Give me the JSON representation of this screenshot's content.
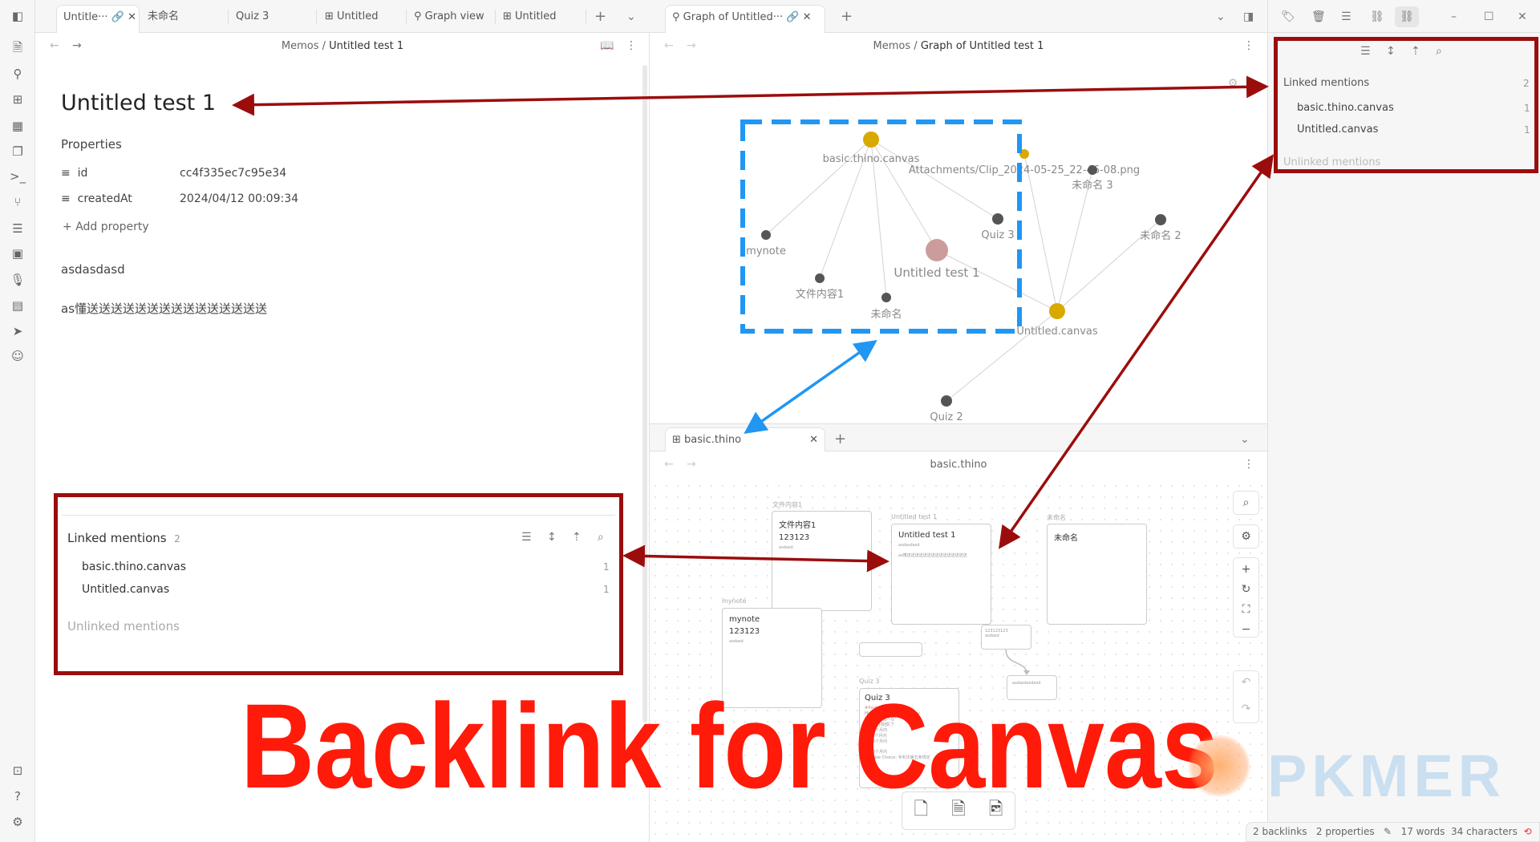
{
  "left_tabs": [
    {
      "label": "Untitle···",
      "active": true
    },
    {
      "label": "未命名"
    },
    {
      "label": "Quiz 3"
    },
    {
      "label": "Untitled",
      "icon": "canvas-icon"
    },
    {
      "label": "Graph view",
      "icon": "graph-icon"
    },
    {
      "label": "Untitled",
      "icon": "canvas-icon"
    }
  ],
  "right_tabs": [
    {
      "label": "Graph of Untitled···",
      "icon": "graph-icon",
      "active": true
    }
  ],
  "note": {
    "breadcrumb_folder": "Memos",
    "breadcrumb_sep": "/",
    "breadcrumb_file": "Untitled test 1",
    "title": "Untitled test 1",
    "properties_heading": "Properties",
    "properties": [
      {
        "key": "id",
        "value": "cc4f335ec7c95e34"
      },
      {
        "key": "createdAt",
        "value": "2024/04/12 00:09:34"
      }
    ],
    "add_property": "Add property",
    "body": [
      "asdasdasd",
      "as懂送送送送送送送送送送送送送送送"
    ]
  },
  "note_backlinks": {
    "linked_label": "Linked mentions",
    "linked_count": "2",
    "items": [
      {
        "name": "basic.thino.canvas",
        "count": "1"
      },
      {
        "name": "Untitled.canvas",
        "count": "1"
      }
    ],
    "unlinked_label": "Unlinked mentions"
  },
  "graph": {
    "breadcrumb_folder": "Memos",
    "breadcrumb_sep": "/",
    "breadcrumb_file": "Graph of Untitled test 1",
    "nodes": {
      "basic": "basic.thino.canvas",
      "mynote": "mynote",
      "file1": "文件内容1",
      "unnamed": "未命名",
      "test1": "Untitled test 1",
      "quiz3": "Quiz 3",
      "attach": "Attachments/Clip_2024-05-25_22-46-08.png",
      "unnamed3": "未命名 3",
      "unnamed2": "未命名 2",
      "untitled_canvas": "Untitled.canvas",
      "quiz2": "Quiz 2"
    },
    "colors": {
      "canvas_node": "#d9a900",
      "active_node": "#cc9c9c",
      "note_node": "#555555"
    }
  },
  "canvas_pane": {
    "tab": "basic.thino",
    "title": "basic.thino",
    "cards": {
      "file1": {
        "label": "文件内容1",
        "title": "文件内容1",
        "line": "123123",
        "small": "asdasd"
      },
      "test1": {
        "label": "Untitled test 1",
        "title": "Untitled test 1",
        "small": "asdasdasd",
        "line2": "as懂送送送送送送送送送送送送送送送"
      },
      "unnamed": {
        "label": "未命名",
        "title": "未命名"
      },
      "mynote": {
        "label": "mynote",
        "title": "mynote",
        "line": "123123",
        "small": "asdasd"
      },
      "small1": {
        "line": "123123123",
        "small": "asdasd"
      },
      "small2": {
        "line": "asdasdasdasd"
      },
      "quiz3": {
        "label": "Quiz 3",
        "title": "Quiz 3",
        "tag": "#flashcards",
        "lines": [
          "Multiple Choice: 根据mm.ov",
          "\"中国的中国人在\"",
          "我专利行政部门\"",
          "b) 28个月内",
          "c) 32个月内",
          "d) 36个月内",
          "?",
          "a) 30个月内",
          "Multiple Choice: 专利法第五条规定"
        ]
      }
    }
  },
  "sidebar_backlinks": {
    "linked_label": "Linked mentions",
    "linked_count": "2",
    "items": [
      {
        "name": "basic.thino.canvas",
        "count": "1"
      },
      {
        "name": "Untitled.canvas",
        "count": "1"
      }
    ],
    "unlinked_label": "Unlinked mentions"
  },
  "status": {
    "backlinks": "2 backlinks",
    "properties": "2 properties",
    "words": "17 words",
    "characters": "34 characters"
  },
  "overlay": {
    "headline": "Backlink for Canvas",
    "watermark": "PKMER",
    "annotation_red": "#9b0d0d",
    "annotation_blue": "#2196f3",
    "headline_color": "#ff1a0a"
  }
}
